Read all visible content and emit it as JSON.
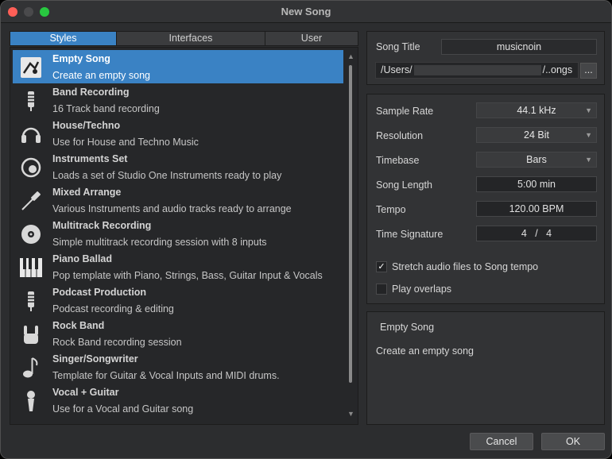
{
  "window": {
    "title": "New Song"
  },
  "tabs": [
    {
      "label": "Styles",
      "active": true
    },
    {
      "label": "Interfaces",
      "active": false
    },
    {
      "label": "User",
      "active": false
    }
  ],
  "templates": [
    {
      "name": "Empty Song",
      "desc": "Create an empty song",
      "icon": "empty-song-icon",
      "selected": true
    },
    {
      "name": "Band Recording",
      "desc": "16 Track band recording",
      "icon": "microphone-icon"
    },
    {
      "name": "House/Techno",
      "desc": "Use for House and Techno Music",
      "icon": "headphones-icon"
    },
    {
      "name": "Instruments Set",
      "desc": "Loads a set of Studio One Instruments ready to play",
      "icon": "knob-icon"
    },
    {
      "name": "Mixed Arrange",
      "desc": "Various Instruments and audio tracks ready to arrange",
      "icon": "cable-icon"
    },
    {
      "name": "Multitrack Recording",
      "desc": "Simple multitrack recording session with 8 inputs",
      "icon": "disc-icon"
    },
    {
      "name": "Piano Ballad",
      "desc": "Pop template with Piano, Strings, Bass, Guitar Input & Vocals",
      "icon": "piano-keys-icon"
    },
    {
      "name": "Podcast Production",
      "desc": "Podcast recording & editing",
      "icon": "microphone-icon"
    },
    {
      "name": "Rock Band",
      "desc": "Rock Band recording session",
      "icon": "rock-hand-icon"
    },
    {
      "name": "Singer/Songwriter",
      "desc": "Template for Guitar & Vocal Inputs and MIDI drums.",
      "icon": "music-note-icon"
    },
    {
      "name": "Vocal + Guitar",
      "desc": "Use for a Vocal and Guitar song",
      "icon": "handheld-mic-icon"
    }
  ],
  "song": {
    "title_label": "Song Title",
    "title_value": "musicnoin",
    "path_start": "/Users/",
    "path_end": "/..ongs",
    "browse_label": "..."
  },
  "settings": {
    "sample_rate_label": "Sample Rate",
    "sample_rate_value": "44.1 kHz",
    "resolution_label": "Resolution",
    "resolution_value": "24 Bit",
    "timebase_label": "Timebase",
    "timebase_value": "Bars",
    "song_length_label": "Song Length",
    "song_length_value": "5:00 min",
    "tempo_label": "Tempo",
    "tempo_value": "120.00 BPM",
    "time_signature_label": "Time Signature",
    "time_sig_numerator": "4",
    "time_sig_separator": "/",
    "time_sig_denominator": "4",
    "stretch_label": "Stretch audio files to Song tempo",
    "stretch_checked": true,
    "overlaps_label": "Play overlaps",
    "overlaps_checked": false
  },
  "description": {
    "title": "Empty Song",
    "text": "Create an empty song"
  },
  "buttons": {
    "cancel": "Cancel",
    "ok": "OK"
  }
}
